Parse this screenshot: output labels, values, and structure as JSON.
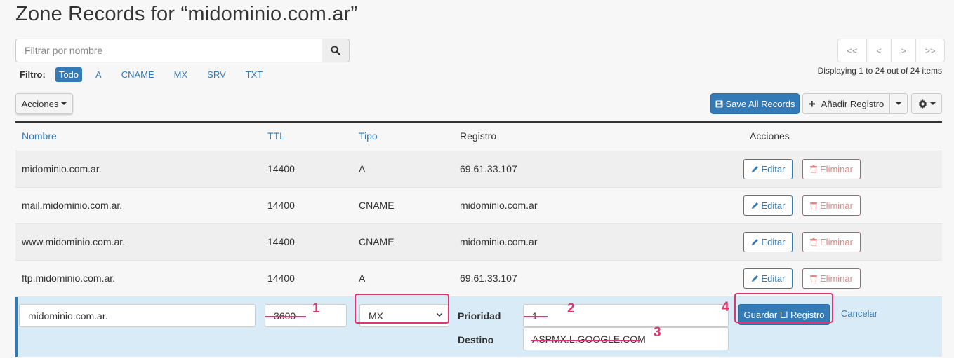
{
  "page": {
    "title": "Zone Records for “midominio.com.ar”"
  },
  "search": {
    "placeholder": "Filtrar por nombre",
    "button_icon": "search-icon"
  },
  "filter": {
    "label": "Filtro:",
    "items": [
      "Todo",
      "A",
      "CNAME",
      "MX",
      "SRV",
      "TXT"
    ],
    "active": "Todo"
  },
  "pagination": {
    "first": "<<",
    "prev": "<",
    "next": ">",
    "last": ">>",
    "displaying": "Displaying 1 to 24 out of 24 items"
  },
  "toolbar": {
    "acciones_label": "Acciones",
    "save_all_label": "Save All Records",
    "add_record_label": "Añadir Registro",
    "settings_icon": "gear-icon"
  },
  "table": {
    "headers": {
      "nombre": "Nombre",
      "ttl": "TTL",
      "tipo": "Tipo",
      "registro": "Registro",
      "acciones": "Acciones"
    },
    "rows": [
      {
        "nombre": "midominio.com.ar.",
        "ttl": "14400",
        "tipo": "A",
        "registro": "69.61.33.107",
        "edit_label": "Editar",
        "delete_label": "Eliminar"
      },
      {
        "nombre": "mail.midominio.com.ar.",
        "ttl": "14400",
        "tipo": "CNAME",
        "registro": "midominio.com.ar",
        "edit_label": "Editar",
        "delete_label": "Eliminar"
      },
      {
        "nombre": "www.midominio.com.ar.",
        "ttl": "14400",
        "tipo": "CNAME",
        "registro": "midominio.com.ar",
        "edit_label": "Editar",
        "delete_label": "Eliminar"
      },
      {
        "nombre": "ftp.midominio.com.ar.",
        "ttl": "14400",
        "tipo": "A",
        "registro": "69.61.33.107",
        "edit_label": "Editar",
        "delete_label": "Eliminar"
      }
    ]
  },
  "edit_row": {
    "name_value": "midominio.com.ar.",
    "ttl_value": "3600",
    "tipo_value": "MX",
    "prioridad_label": "Prioridad",
    "prioridad_value": "1",
    "destino_label": "Destino",
    "destino_value": "ASPMX.L.GOOGLE.COM",
    "save_label": "Guardar El Registro",
    "cancel_label": "Cancelar"
  },
  "annotations": {
    "step1": "1",
    "step2": "2",
    "step3": "3",
    "step4": "4",
    "color": "#e0356e"
  },
  "colors": {
    "primary": "#337ab7",
    "danger": "#d9534f",
    "edit_row_bg": "#d9ebf7"
  }
}
